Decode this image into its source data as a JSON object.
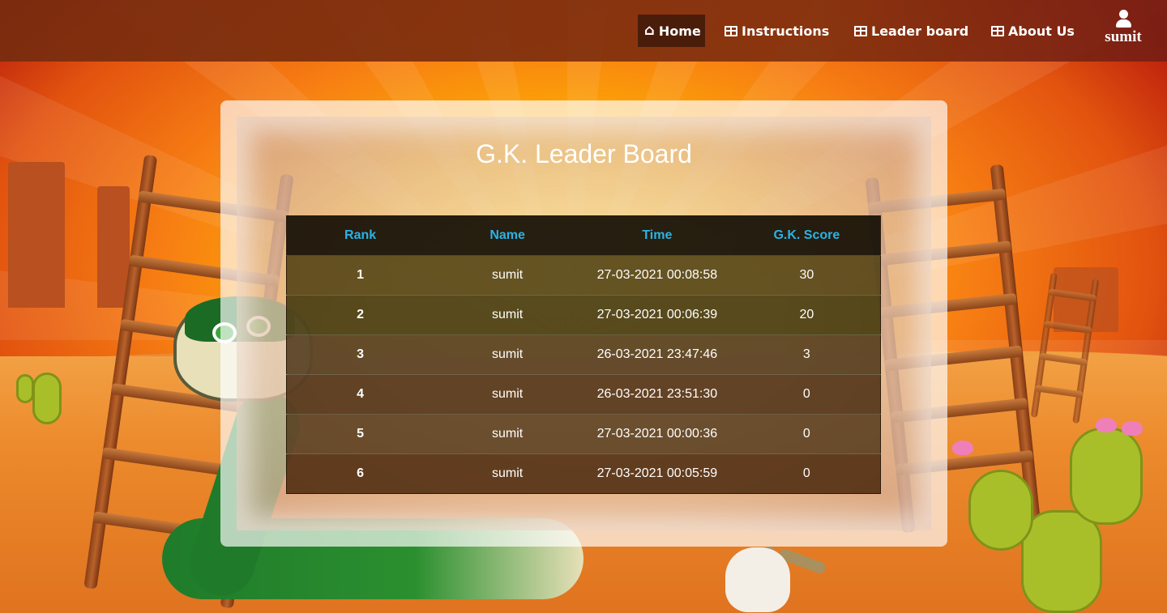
{
  "nav": {
    "items": [
      {
        "label": "Home",
        "icon": "home-icon",
        "active": true
      },
      {
        "label": "Instructions",
        "icon": "grid-icon",
        "active": false
      },
      {
        "label": "Leader board",
        "icon": "grid-icon",
        "active": false
      },
      {
        "label": "About Us",
        "icon": "grid-icon",
        "active": false
      }
    ],
    "user": {
      "name": "sumit",
      "icon": "user-icon"
    }
  },
  "board": {
    "title": "G.K. Leader Board",
    "columns": [
      "Rank",
      "Name",
      "Time",
      "G.K. Score"
    ],
    "rows": [
      {
        "rank": "1",
        "name": "sumit",
        "time": "27-03-2021 00:08:58",
        "score": "30"
      },
      {
        "rank": "2",
        "name": "sumit",
        "time": "27-03-2021 00:06:39",
        "score": "20"
      },
      {
        "rank": "3",
        "name": "sumit",
        "time": "26-03-2021 23:47:46",
        "score": "3"
      },
      {
        "rank": "4",
        "name": "sumit",
        "time": "26-03-2021 23:51:30",
        "score": "0"
      },
      {
        "rank": "5",
        "name": "sumit",
        "time": "27-03-2021 00:00:36",
        "score": "0"
      },
      {
        "rank": "6",
        "name": "sumit",
        "time": "27-03-2021 00:05:59",
        "score": "0"
      }
    ]
  },
  "colors": {
    "navbar": "#7e2e0e",
    "active_nav": "#4a1d0a",
    "header_text": "#2ab3e6",
    "text": "#ffffff"
  }
}
